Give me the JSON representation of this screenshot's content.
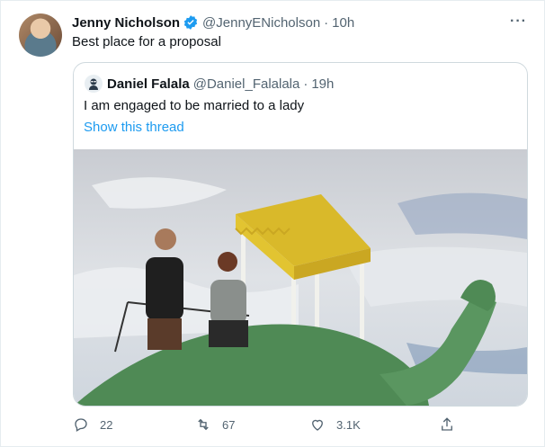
{
  "author": {
    "name": "Jenny Nicholson",
    "handle": "@JennyENicholson",
    "time": "10h",
    "separator": "·"
  },
  "tweet": {
    "text": "Best place for a proposal"
  },
  "quoted": {
    "author_name": "Daniel Falala",
    "author_handle": "@Daniel_Falalala",
    "time": "19h",
    "separator": "·",
    "text": "I am engaged to be married to a lady",
    "show_thread": "Show this thread"
  },
  "actions": {
    "replies": "22",
    "retweets": "67",
    "likes": "3.1K"
  },
  "colors": {
    "accent": "#1d9bf0",
    "muted": "#536471",
    "border": "#cfd9de"
  },
  "icons": [
    "verified-badge-icon",
    "more-icon",
    "reply-icon",
    "retweet-icon",
    "like-icon",
    "share-icon"
  ]
}
